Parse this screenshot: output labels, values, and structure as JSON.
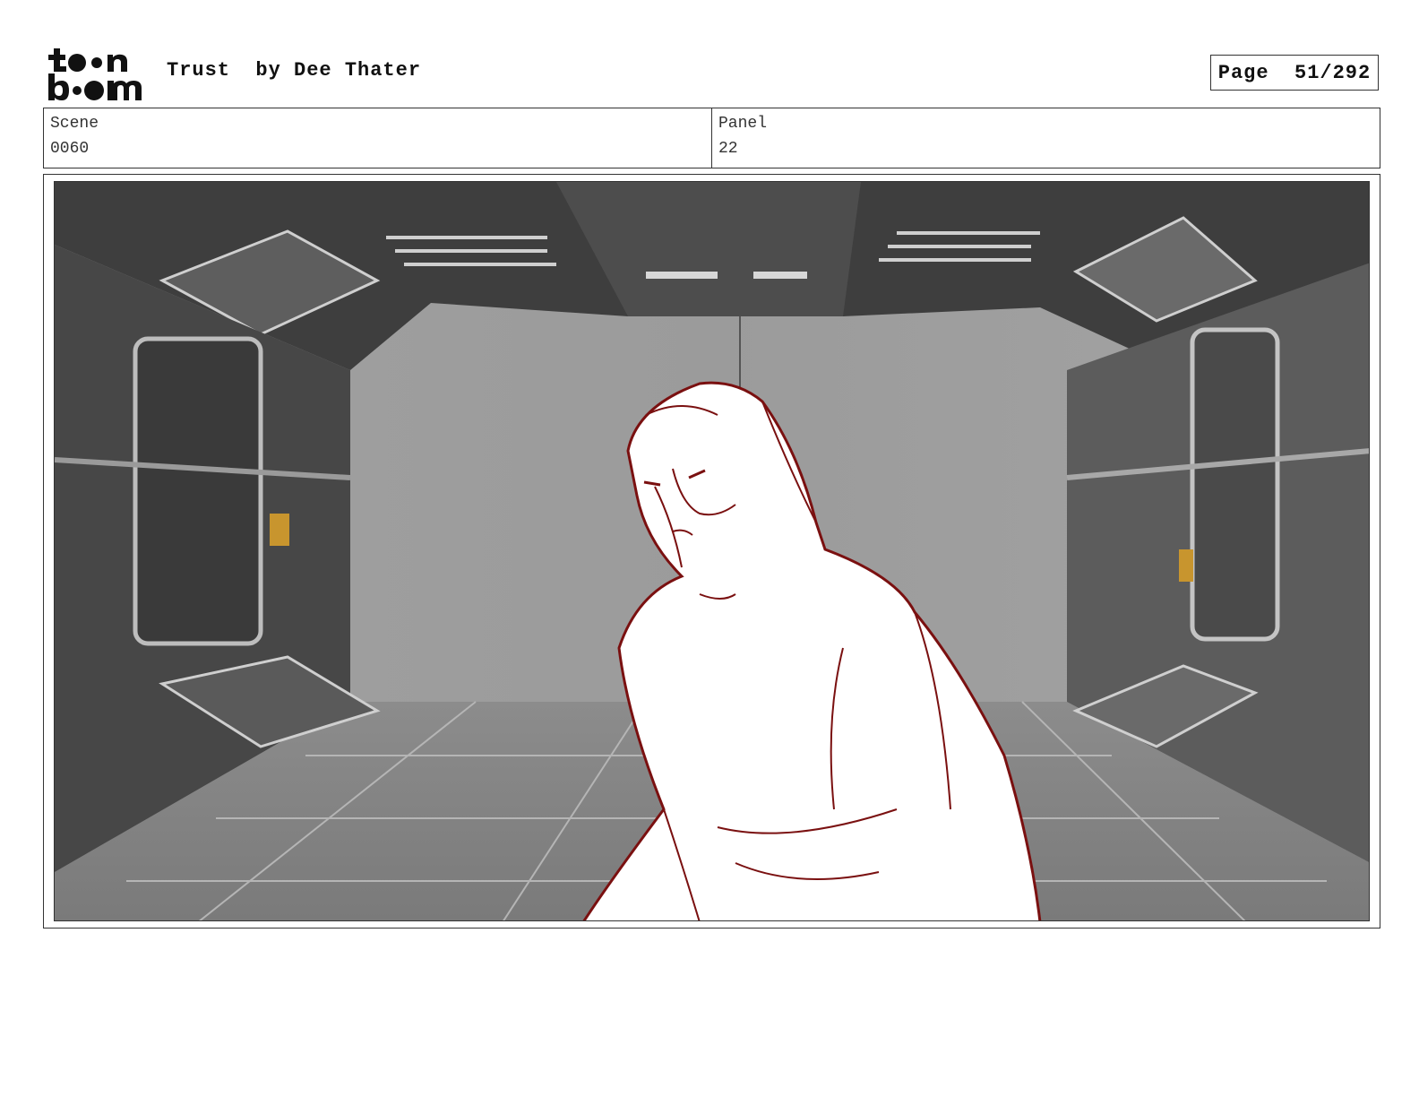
{
  "header": {
    "logo_text": "toon boom",
    "title": "Trust  by Dee Thater",
    "page_label": "Page  51/292"
  },
  "meta": {
    "scene_label": "Scene",
    "scene_value": "0060",
    "panel_label": "Panel",
    "panel_value": "22"
  },
  "panel": {
    "description_colors": {
      "sketch_line": "#7a1010",
      "wall_dark": "#4a4a4a",
      "background_grey": "#9e9e9e",
      "floor": "#8a8a8a"
    }
  }
}
